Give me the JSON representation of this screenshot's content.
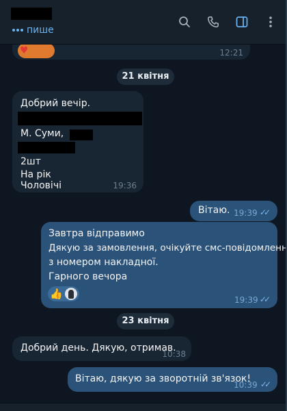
{
  "header": {
    "status": "пише",
    "icons": [
      "search-icon",
      "phone-icon",
      "sidebar-panel-icon",
      "more-icon"
    ]
  },
  "messages": {
    "top": {
      "time": "12:21",
      "reaction": "heart-reaction"
    },
    "date1": "21 квітня",
    "m1": {
      "line1": "Добрий вечір.",
      "line2": "М. Суми,",
      "line3": "2шт",
      "line4": "На рік",
      "line5": "Чоловічі",
      "time": "19:36"
    },
    "m2": {
      "text": "Вітаю.",
      "time": "19:39",
      "status": "read"
    },
    "m3": {
      "line1": "Завтра відправимо",
      "line2": "Дякую за замовлення, очікуйте смс-повідомлення",
      "line3": "з номером накладної.",
      "line4": "Гарного вечора",
      "reaction": "👍",
      "time": "19:39",
      "status": "read"
    },
    "date2": "23 квітня",
    "m4": {
      "text": "Добрий день. Дякую, отримав.",
      "time": "10:38"
    },
    "m5": {
      "text": "Вітаю, дякую за зворотній зв'язок!",
      "time": "10:39",
      "status": "read"
    }
  },
  "colors": {
    "background": "#0e1621",
    "incoming": "#182533",
    "outgoing": "#2b5278",
    "accent": "#6ab3f3"
  }
}
